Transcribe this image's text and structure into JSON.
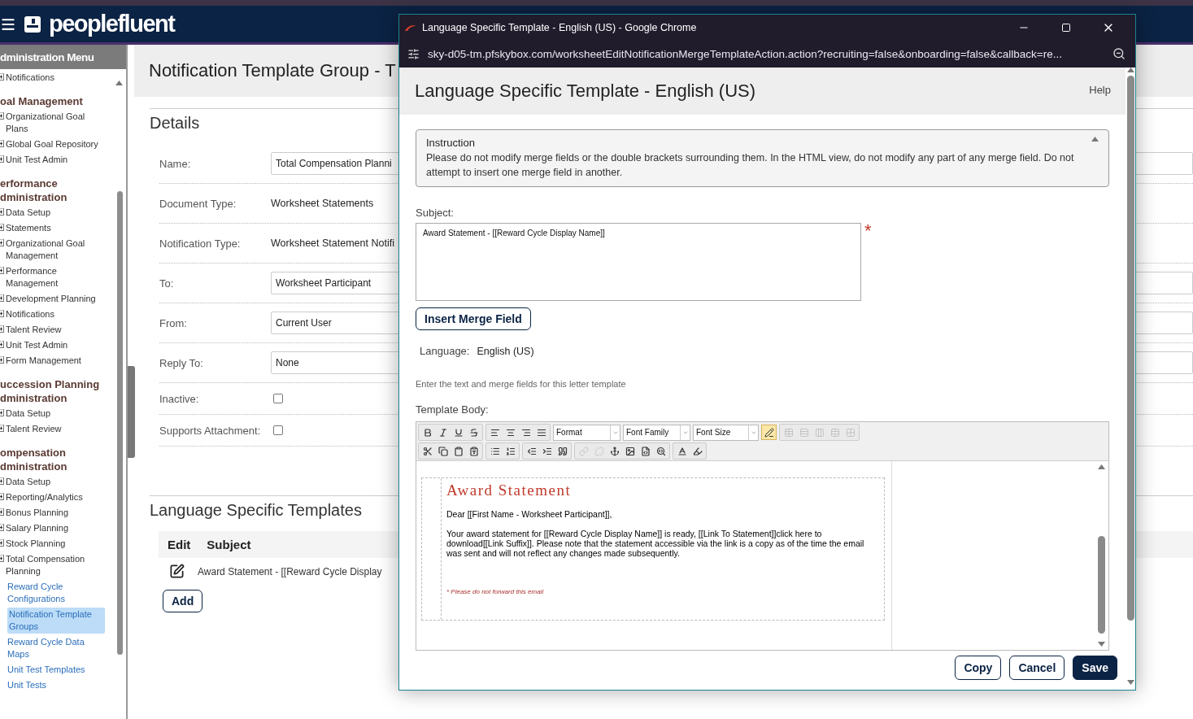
{
  "app": {
    "brand": "peoplefluent"
  },
  "sidebar": {
    "title": "dministration Menu",
    "sections": [
      {
        "items": [
          {
            "label": "Notifications",
            "kind": "expandable",
            "selected": false
          }
        ]
      },
      {
        "heading": "oal Management",
        "items": [
          {
            "label": "Organizational Goal Plans",
            "kind": "expandable",
            "selected": false
          },
          {
            "label": "Global Goal Repository",
            "kind": "expandable",
            "selected": false
          },
          {
            "label": "Unit Test Admin",
            "kind": "expandable",
            "selected": false
          }
        ]
      },
      {
        "heading": "erformance dministration",
        "items": [
          {
            "label": "Data Setup",
            "kind": "expandable",
            "selected": false
          },
          {
            "label": "Statements",
            "kind": "expandable",
            "selected": false
          },
          {
            "label": "Organizational Goal Management",
            "kind": "expandable",
            "selected": false
          },
          {
            "label": "Performance Management",
            "kind": "expandable",
            "selected": false
          },
          {
            "label": "Development Planning",
            "kind": "expandable",
            "selected": false
          },
          {
            "label": "Notifications",
            "kind": "expandable",
            "selected": false
          },
          {
            "label": "Talent Review",
            "kind": "expandable",
            "selected": false
          },
          {
            "label": "Unit Test Admin",
            "kind": "expandable",
            "selected": false
          },
          {
            "label": "Form Management",
            "kind": "expandable",
            "selected": false
          }
        ]
      },
      {
        "heading": "uccession Planning dministration",
        "items": [
          {
            "label": "Data Setup",
            "kind": "expandable",
            "selected": false
          },
          {
            "label": "Talent Review",
            "kind": "expandable",
            "selected": false
          }
        ]
      },
      {
        "heading": "ompensation dministration",
        "items": [
          {
            "label": "Data Setup",
            "kind": "expandable",
            "selected": false
          },
          {
            "label": "Reporting/Analytics",
            "kind": "expandable",
            "selected": false
          },
          {
            "label": "Bonus Planning",
            "kind": "expandable",
            "selected": false
          },
          {
            "label": "Salary Planning",
            "kind": "expandable",
            "selected": false
          },
          {
            "label": "Stock Planning",
            "kind": "expandable",
            "selected": false
          },
          {
            "label": "Total Compensation Planning",
            "kind": "expandable",
            "selected": false
          },
          {
            "label": "Reward Cycle Configurations",
            "kind": "link",
            "selected": false
          },
          {
            "label": "Notification Template Groups",
            "kind": "link",
            "selected": true
          },
          {
            "label": "Reward Cycle Data Maps",
            "kind": "link",
            "selected": false
          },
          {
            "label": "Unit Test Templates",
            "kind": "link",
            "selected": false
          },
          {
            "label": "Unit Tests",
            "kind": "link",
            "selected": false
          }
        ]
      }
    ]
  },
  "main": {
    "title": "Notification Template Group - T",
    "details_heading": "Details",
    "fields": [
      {
        "label": "Name:",
        "kind": "input",
        "value": "Total Compensation Planni"
      },
      {
        "label": "Document Type:",
        "kind": "text",
        "value": "Worksheet Statements"
      },
      {
        "label": "Notification Type:",
        "kind": "text",
        "value": "Worksheet Statement Notifi"
      },
      {
        "label": "To:",
        "kind": "input",
        "value": "Worksheet Participant"
      },
      {
        "label": "From:",
        "kind": "input",
        "value": "Current User"
      },
      {
        "label": "Reply To:",
        "kind": "input",
        "value": "None"
      },
      {
        "label": "Inactive:",
        "kind": "checkbox",
        "checked": false
      },
      {
        "label": "Supports Attachment:",
        "kind": "checkbox",
        "checked": false
      }
    ],
    "templates": {
      "heading": "Language Specific Templates",
      "columns": [
        "Edit",
        "Subject"
      ],
      "rows": [
        {
          "subject": "Award Statement - [[Reward Cycle Display"
        }
      ],
      "add_button": "Add"
    }
  },
  "popup": {
    "window_title": "Language Specific Template - English (US) - Google Chrome",
    "url": "sky-d05-tm.pfskybox.com/worksheetEditNotificationMergeTemplateAction.action?recruiting=false&onboarding=false&callback=re...",
    "page_title": "Language Specific Template - English (US)",
    "help": "Help",
    "instruction": {
      "title": "Instruction",
      "expanded": true,
      "text": "Please do not modify merge fields or the double brackets surrounding them. In the HTML view, do not modify any part of any merge field. Do not attempt to insert one merge field in another."
    },
    "subject": {
      "label": "Subject:",
      "value": "Award Statement - [[Reward Cycle Display Name]]",
      "required_mark": "*"
    },
    "insert_button": "Insert Merge Field",
    "language": {
      "label": "Language:",
      "value": "English (US)"
    },
    "hint": "Enter the text and merge fields for this letter template",
    "body_label": "Template Body:",
    "dropdowns": [
      "Format",
      "Font Family",
      "Font Size"
    ],
    "body": {
      "heading": "Award Statement",
      "greeting": "Dear [[First Name - Worksheet Participant]],",
      "paragraph": "Your award statement for [[Reward Cycle Display Name]] is ready, [[Link To Statement]]click here to download[[Link Suffix]]. Please note that the statement accessible via the link is a copy as of the time the email was sent and will not reflect any changes made subsequently.",
      "footnote": "* Please do not forward this email"
    },
    "buttons": [
      {
        "label": "Copy",
        "kind": "secondary"
      },
      {
        "label": "Cancel",
        "kind": "secondary"
      },
      {
        "label": "Save",
        "kind": "primary"
      }
    ]
  }
}
